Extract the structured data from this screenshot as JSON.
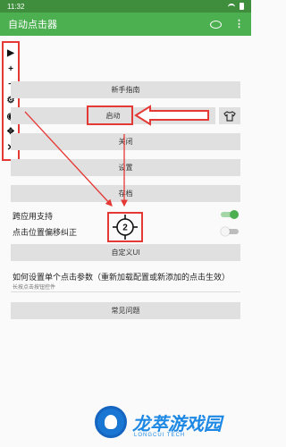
{
  "status_bar": {
    "time": "11:32"
  },
  "app_bar": {
    "title": "自动点击器",
    "icons": [
      "comment-icon",
      "more-vert-icon"
    ],
    "more_glyph": "⋮"
  },
  "float_toolbar": {
    "items": [
      {
        "icon": "play-icon",
        "glyph": "▶"
      },
      {
        "icon": "add-icon",
        "glyph": "+"
      },
      {
        "icon": "remove-icon",
        "glyph": "−"
      },
      {
        "icon": "settings-icon",
        "glyph": "⚙"
      },
      {
        "icon": "eye-off-icon",
        "glyph": "◉"
      },
      {
        "icon": "move-icon",
        "glyph": "✥"
      },
      {
        "icon": "close-icon",
        "glyph": "✕"
      }
    ]
  },
  "main": {
    "guide_label": "新手指南",
    "start_label": "启动",
    "stop_label": "关闭",
    "settings_label": "设置",
    "save_label": "存档",
    "cross_app_label": "跨应用支持",
    "cross_app_on": true,
    "offset_label": "点击位置偏移纠正",
    "offset_on": false,
    "target_number": "2",
    "custom_ui_label": "自定义UI",
    "howto_title": "如何设置单个点击参数（重新加载配置或新添加的点击生效）",
    "howto_sub": "长按点击按钮控件",
    "faq_label": "常见问题"
  },
  "watermark": {
    "brand": "龙萃游戏园",
    "sub": "LONGCUI TECH"
  },
  "colors": {
    "primary": "#4caf50",
    "status": "#3e8e3e",
    "annotation": "#e53935"
  }
}
